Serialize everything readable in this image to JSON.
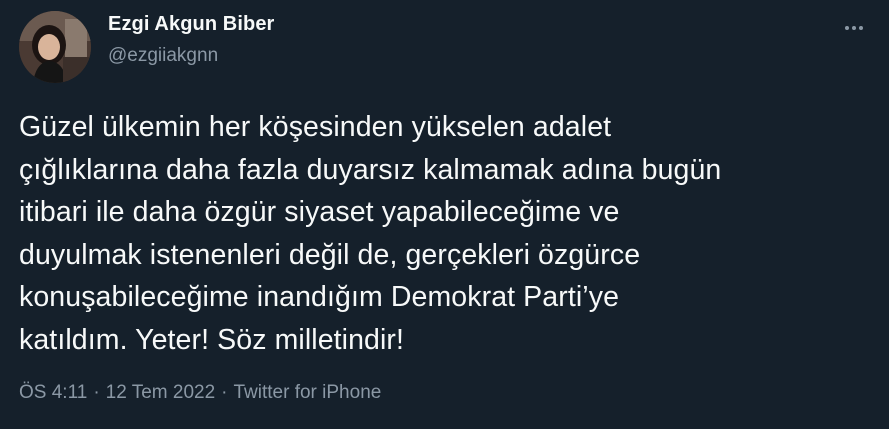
{
  "author": {
    "name": "Ezgi Akgun Biber",
    "handle": "@ezgiiakgnn",
    "avatar_icon": "profile-photo"
  },
  "more_icon": "more-horizontal-icon",
  "tweet": {
    "lines": [
      "Güzel ülkemin her köşesinden yükselen adalet",
      "çığlıklarına daha fazla duyarsız kalmamak adına bugün",
      "itibari ile daha özgür siyaset yapabileceğime ve",
      "duyulmak istenenleri değil de, gerçekleri özgürce",
      "konuşabileceğime inandığım Demokrat Parti’ye",
      "katıldım. Yeter! Söz milletindir!"
    ]
  },
  "meta": {
    "time": "ÖS 4:11",
    "date": "12 Tem 2022",
    "source": "Twitter for iPhone",
    "separator": "·"
  },
  "colors": {
    "background": "#15202b",
    "text_primary": "#f7f9f9",
    "text_secondary": "#8b98a5"
  }
}
